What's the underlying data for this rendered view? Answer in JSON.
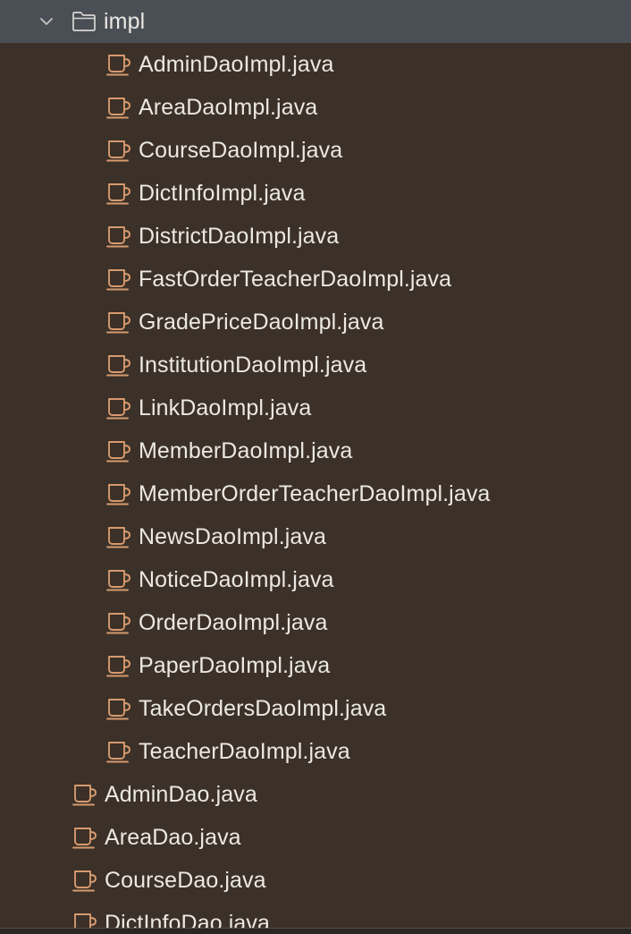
{
  "tree": {
    "folder": {
      "name": "impl",
      "expanded": true,
      "icon": "folder-icon"
    },
    "impl_files": [
      "AdminDaoImpl.java",
      "AreaDaoImpl.java",
      "CourseDaoImpl.java",
      "DictInfoImpl.java",
      "DistrictDaoImpl.java",
      "FastOrderTeacherDaoImpl.java",
      "GradePriceDaoImpl.java",
      "InstitutionDaoImpl.java",
      "LinkDaoImpl.java",
      "MemberDaoImpl.java",
      "MemberOrderTeacherDaoImpl.java",
      "NewsDaoImpl.java",
      "NoticeDaoImpl.java",
      "OrderDaoImpl.java",
      "PaperDaoImpl.java",
      "TakeOrdersDaoImpl.java",
      "TeacherDaoImpl.java"
    ],
    "dao_files": [
      "AdminDao.java",
      "AreaDao.java",
      "CourseDao.java",
      "DictInfoDao.java"
    ],
    "file_icon": "java-class-icon"
  },
  "colors": {
    "background": "#3b3128",
    "selected_row": "#4a4f55",
    "text": "#ece8e3",
    "java_icon": "#d79a6e",
    "folder_icon": "#d8d6d3"
  }
}
